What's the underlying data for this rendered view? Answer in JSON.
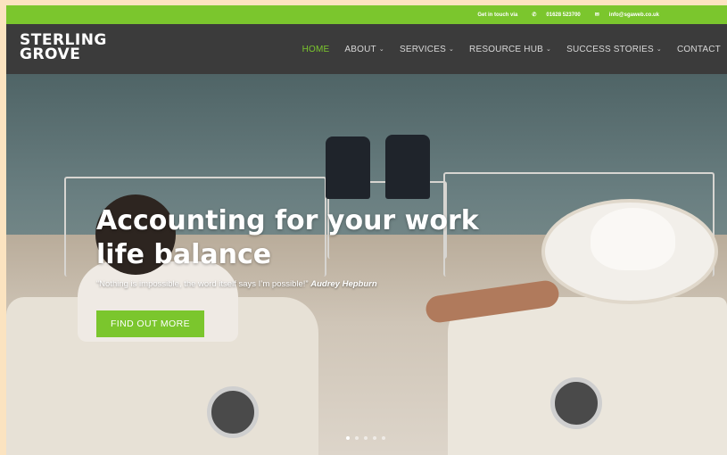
{
  "topbar": {
    "intro": "Get in touch via",
    "phone_icon": "phone-icon",
    "phone": "01628 523700",
    "email_icon": "envelope-icon",
    "email": "info@sgaweb.co.uk"
  },
  "logo": {
    "line1": "STERLING",
    "line2": "GROVE"
  },
  "nav": {
    "items": [
      {
        "label": "HOME",
        "active": true,
        "dropdown": false
      },
      {
        "label": "ABOUT",
        "active": false,
        "dropdown": true
      },
      {
        "label": "SERVICES",
        "active": false,
        "dropdown": true
      },
      {
        "label": "RESOURCE HUB",
        "active": false,
        "dropdown": true
      },
      {
        "label": "SUCCESS STORIES",
        "active": false,
        "dropdown": true
      },
      {
        "label": "CONTACT",
        "active": false,
        "dropdown": false
      }
    ],
    "chevron_icon": "chevron-down-icon"
  },
  "hero": {
    "headline_line1": "Accounting for your work",
    "headline_line2": "life balance",
    "quote": "“Nothing is impossible, the word itself says I’m possible!”",
    "author": "Audrey Hepburn",
    "cta_label": "FIND OUT MORE",
    "slides": 5,
    "active_slide": 1
  },
  "colors": {
    "accent": "#7bc62d",
    "navbar": "#3b3b3b",
    "page_bg": "#fbe3c0"
  }
}
